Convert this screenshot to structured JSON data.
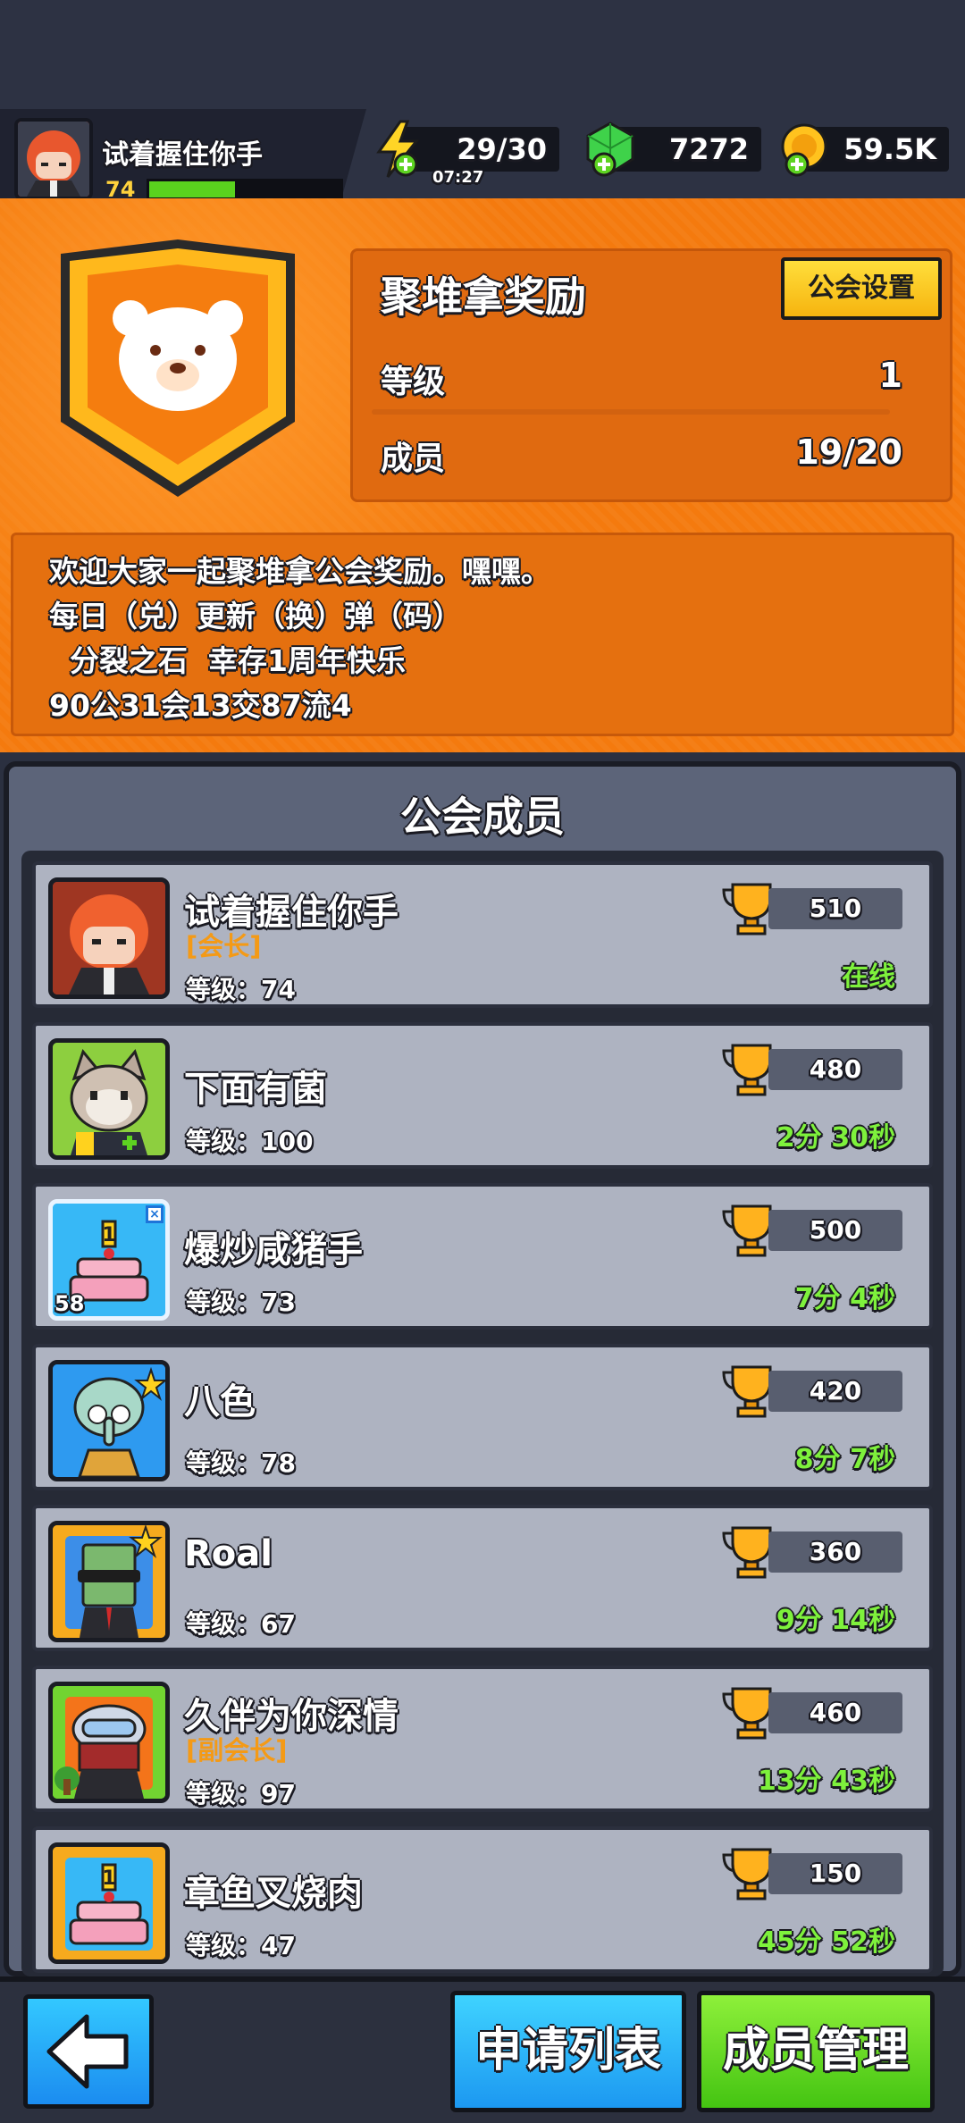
{
  "player": {
    "name": "试着握住你手",
    "level": "74",
    "xp_fraction": 0.45
  },
  "resources": {
    "energy": {
      "value": "29/30",
      "timer": "07:27"
    },
    "gems": {
      "value": "7272"
    },
    "coins": {
      "value": "59.5K"
    }
  },
  "guild": {
    "name": "聚堆拿奖励",
    "settings_label": "公会设置",
    "level_label": "等级",
    "level_value": "1",
    "members_label": "成员",
    "members_value": "19/20",
    "notice_lines": [
      "欢迎大家一起聚堆拿公会奖励。嘿嘿。",
      "每日（兑）更新（换）弹（码）",
      "  分裂之石  幸存1周年快乐",
      "90公31会13交87流4"
    ]
  },
  "members_panel": {
    "title": "公会成员",
    "members": [
      {
        "name": "试着握住你手",
        "role": "[会长]",
        "level": "等级：74",
        "trophies": "510",
        "status": "在线"
      },
      {
        "name": "下面有菌",
        "role": "",
        "level": "等级：100",
        "trophies": "480",
        "status": "2分 30秒"
      },
      {
        "name": "爆炒咸猪手",
        "role": "",
        "level": "等级：73",
        "trophies": "500",
        "status": "7分 4秒",
        "avatar_badge": "58"
      },
      {
        "name": "八色",
        "role": "",
        "level": "等级：78",
        "trophies": "420",
        "status": "8分 7秒"
      },
      {
        "name": "Roal",
        "role": "",
        "level": "等级：67",
        "trophies": "360",
        "status": "9分 14秒"
      },
      {
        "name": "久伴为你深情",
        "role": "[副会长]",
        "level": "等级：97",
        "trophies": "460",
        "status": "13分 43秒"
      },
      {
        "name": "章鱼叉烧肉",
        "role": "",
        "level": "等级：47",
        "trophies": "150",
        "status": "45分 52秒"
      }
    ]
  },
  "bottom": {
    "back_icon": "arrow-left-icon",
    "apply_label": "申请列表",
    "manage_label": "成员管理"
  },
  "colors": {
    "orange": "#f47a0e",
    "online_green": "#7ef13c",
    "role_orange": "#f49a16"
  }
}
